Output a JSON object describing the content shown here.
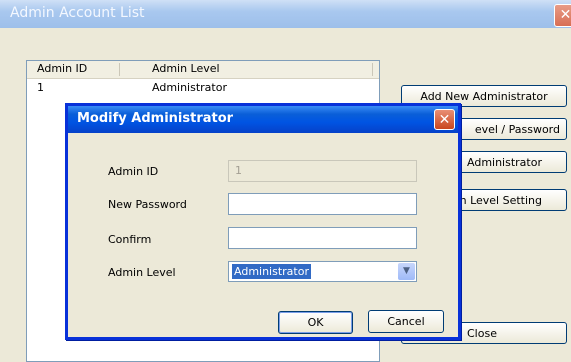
{
  "main_window": {
    "title": "Admin Account List",
    "close_glyph": "✕",
    "list": {
      "columns": [
        "Admin ID",
        "Admin Level"
      ],
      "rows": [
        {
          "id": "1",
          "level": "Administrator"
        }
      ]
    },
    "buttons": {
      "add_new": "Add New Administrator",
      "modify_level_password": "evel / Password",
      "delete_admin": "Administrator",
      "level_setting": "n Level Setting",
      "close": "Close"
    }
  },
  "dialog": {
    "title": "Modify Administrator",
    "close_glyph": "✕",
    "labels": {
      "admin_id": "Admin ID",
      "new_password": "New Password",
      "confirm": "Confirm",
      "admin_level": "Admin Level"
    },
    "values": {
      "admin_id": "1",
      "new_password": "",
      "confirm": "",
      "admin_level": "Administrator"
    },
    "ok": "OK",
    "cancel": "Cancel",
    "dropdown_icon": "chevron-down-icon"
  }
}
